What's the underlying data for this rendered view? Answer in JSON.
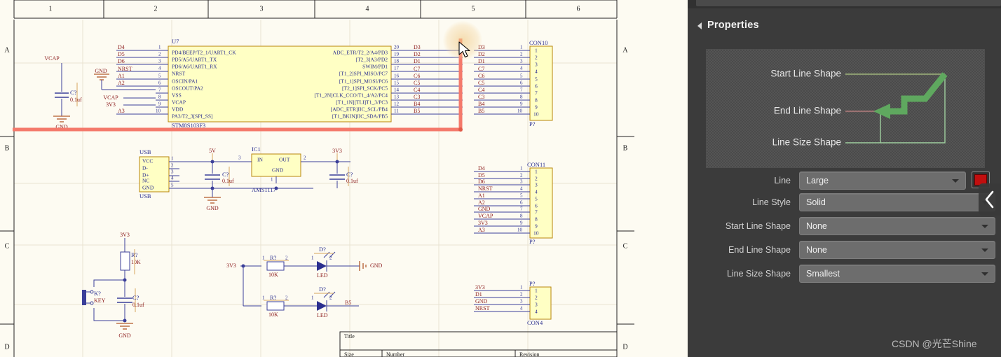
{
  "app": {
    "watermark": "CSDN @光芒Shine"
  },
  "panel": {
    "title": "Properties",
    "collapse_icon": "chevron-left-icon",
    "preview": {
      "labels": [
        {
          "text": "Start Line Shape"
        },
        {
          "text": "End Line Shape"
        },
        {
          "text": "Line Size Shape"
        }
      ],
      "accent_color": "#5fa85f",
      "leader_color": "#9fcf9f"
    },
    "rows": [
      {
        "label": "Line",
        "value": "Large",
        "name": "line"
      },
      {
        "label": "Line Style",
        "value": "Solid",
        "name": "line-style"
      },
      {
        "label": "Start Line Shape",
        "value": "None",
        "name": "start-line-shape"
      },
      {
        "label": "End Line Shape",
        "value": "None",
        "name": "end-line-shape"
      },
      {
        "label": "Line Size Shape",
        "value": "Smallest",
        "name": "line-size-shape"
      }
    ],
    "color_swatch": "#c10f0f"
  },
  "sheet": {
    "ruler_top": [
      "1",
      "2",
      "3",
      "4",
      "5",
      "6"
    ],
    "rows_left": [
      "A",
      "B",
      "C",
      "D"
    ],
    "rows_right": [
      "A",
      "B",
      "C",
      "D"
    ],
    "title_block": {
      "title_label": "Title",
      "size_label": "Size",
      "number_label": "Number",
      "revision_label": "Revision"
    },
    "selected_wire_color": "#f4796b"
  },
  "schematic": {
    "u7": {
      "ref": "U7",
      "part": "STM8S103F3",
      "left_pins": [
        {
          "num": "1",
          "name": "PD4/BEEP/T2_1/UART1_CK",
          "net": "D4"
        },
        {
          "num": "2",
          "name": "PD5/A5/UART1_TX",
          "net": "D5"
        },
        {
          "num": "3",
          "name": "PD6/A6/UART1_RX",
          "net": "D6"
        },
        {
          "num": "4",
          "name": "NRST",
          "net": "NRST"
        },
        {
          "num": "5",
          "name": "OSCIN/PA1",
          "net": "A1"
        },
        {
          "num": "6",
          "name": "OSCOUT/PA2",
          "net": "A2"
        },
        {
          "num": "7",
          "name": "VSS",
          "net": ""
        },
        {
          "num": "8",
          "name": "VCAP",
          "net": ""
        },
        {
          "num": "9",
          "name": "VDD",
          "net": ""
        },
        {
          "num": "10",
          "name": "PA3/T2_3[SPI_SS]",
          "net": "A3"
        }
      ],
      "right_pins": [
        {
          "num": "20",
          "name": "ADC_ETR/T2_2/A4/PD3",
          "net": "D3"
        },
        {
          "num": "19",
          "name": "[T2_3]A3/PD2",
          "net": "D2"
        },
        {
          "num": "18",
          "name": "SWIM/PD1",
          "net": "D1"
        },
        {
          "num": "17",
          "name": "[T1_2]SPI_MISO/PC7",
          "net": "C7"
        },
        {
          "num": "16",
          "name": "[T1_1]SPI_MOSI/PC6",
          "net": "C6"
        },
        {
          "num": "15",
          "name": "[T2_1]SPI_SCK/PC5",
          "net": "C5"
        },
        {
          "num": "14",
          "name": "[T1_2N]CLK_CCO/T1_4/A2/PC4",
          "net": "C4"
        },
        {
          "num": "13",
          "name": "[T1_1N][TLI]T1_3/PC3",
          "net": "C3"
        },
        {
          "num": "12",
          "name": "[ADC_ETR]IIC_SCL/PB4",
          "net": "B4"
        },
        {
          "num": "11",
          "name": "[T1_BKIN]IIC_SDA/PB5",
          "net": "B5"
        }
      ]
    },
    "con10": {
      "ref": "CON10",
      "part": "P?",
      "pins": [
        "1",
        "2",
        "3",
        "4",
        "5",
        "6",
        "7",
        "8",
        "9",
        "10"
      ],
      "pin_nums": [
        "1",
        "2",
        "3",
        "4",
        "5",
        "6",
        "7",
        "8",
        "9",
        "10"
      ],
      "nets": [
        "D3",
        "D2",
        "D1",
        "C7",
        "C6",
        "C5",
        "C4",
        "C3",
        "B4",
        "B5"
      ]
    },
    "con11": {
      "ref": "CON11",
      "part": "P?",
      "pins": [
        "1",
        "2",
        "3",
        "4",
        "5",
        "6",
        "7",
        "8",
        "9",
        "10"
      ],
      "pin_nums": [
        "1",
        "2",
        "3",
        "4",
        "5",
        "6",
        "7",
        "8",
        "9",
        "10"
      ],
      "nets": [
        "D4",
        "D5",
        "D6",
        "NRST",
        "A1",
        "A2",
        "GND",
        "VCAP",
        "3V3",
        "A3"
      ]
    },
    "con4": {
      "ref": "P?",
      "part": "CON4",
      "pins": [
        "1",
        "2",
        "3",
        "4"
      ],
      "pin_nums": [
        "1",
        "2",
        "3",
        "4"
      ],
      "nets": [
        "3V3",
        "D1",
        "GND",
        "NRST"
      ]
    },
    "usb": {
      "ref": "USB",
      "part": "USB",
      "pins": [
        "VCC",
        "D-",
        "D+",
        "NC",
        "GND"
      ],
      "pin_nums": [
        "1",
        "2",
        "3",
        "4",
        "5"
      ]
    },
    "regulator": {
      "ref": "IC1",
      "part": "AMS1117",
      "pin_in": "IN",
      "pin_out": "OUT",
      "pin_gnd": "GND",
      "num_in": "3",
      "num_out": "2",
      "num_gnd": "1"
    },
    "caps": [
      {
        "ref": "C?",
        "val": "0.1uf",
        "net_top": "VCAP",
        "net_bot": "GND"
      },
      {
        "ref": "C?",
        "val": "0.1uf",
        "net_top": "5V",
        "net_bot": "GND"
      },
      {
        "ref": "C?",
        "val": "0.1uf",
        "net_top": "3V3",
        "net_bot": ""
      },
      {
        "ref": "C?",
        "val": "0.1uf",
        "net_top": "",
        "net_bot": "GND"
      }
    ],
    "resistors": [
      {
        "ref": "R?",
        "val": "10K"
      },
      {
        "ref": "R?",
        "val": "10K"
      },
      {
        "ref": "R?",
        "val": "10K"
      }
    ],
    "leds": [
      {
        "ref": "D?",
        "val": "LED",
        "out_net": "GND"
      },
      {
        "ref": "D?",
        "val": "LED",
        "out_net": "B5"
      }
    ],
    "key": {
      "ref": "K?",
      "val": "KEY"
    },
    "nets": [
      "VCAP",
      "GND",
      "3V3",
      "5V",
      "NRST",
      "B5",
      "D1"
    ]
  }
}
